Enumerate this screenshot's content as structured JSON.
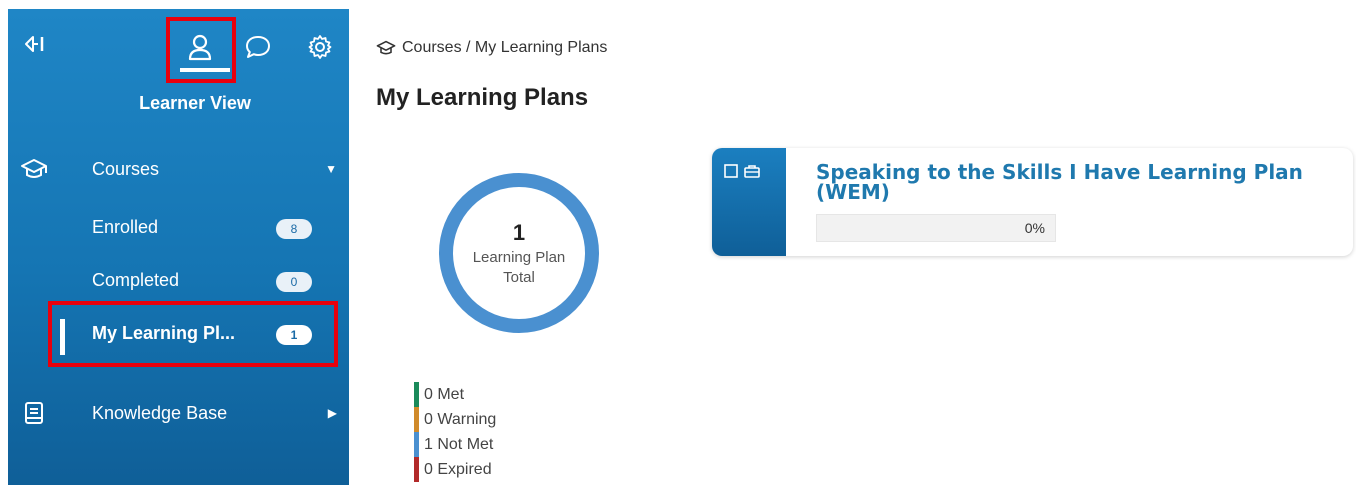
{
  "sidebar": {
    "view_label": "Learner View",
    "courses": {
      "label": "Courses",
      "items": [
        {
          "label": "Enrolled",
          "count": "8"
        },
        {
          "label": "Completed",
          "count": "0"
        },
        {
          "label": "My Learning Pl...",
          "count": "1"
        }
      ]
    },
    "knowledge_base": {
      "label": "Knowledge Base"
    }
  },
  "breadcrumb": "Courses / My Learning Plans",
  "page_title": "My Learning Plans",
  "summary": {
    "count": "1",
    "label_line1": "Learning Plan",
    "label_line2": "Total"
  },
  "legend": [
    {
      "label": "0 Met",
      "color": "#1a8a5a"
    },
    {
      "label": "0 Warning",
      "color": "#d08a2a"
    },
    {
      "label": "1 Not Met",
      "color": "#4a90d0"
    },
    {
      "label": "0 Expired",
      "color": "#b22a2a"
    }
  ],
  "plan_card": {
    "title": "Speaking to the Skills I Have Learning Plan (WEM)",
    "progress_label": "0%",
    "progress_fraction": 0
  },
  "colors": {
    "sidebar": "#1a7cbd",
    "accent": "#1f79ae",
    "highlight": "#e8000d",
    "donut": "#4a90d0"
  }
}
